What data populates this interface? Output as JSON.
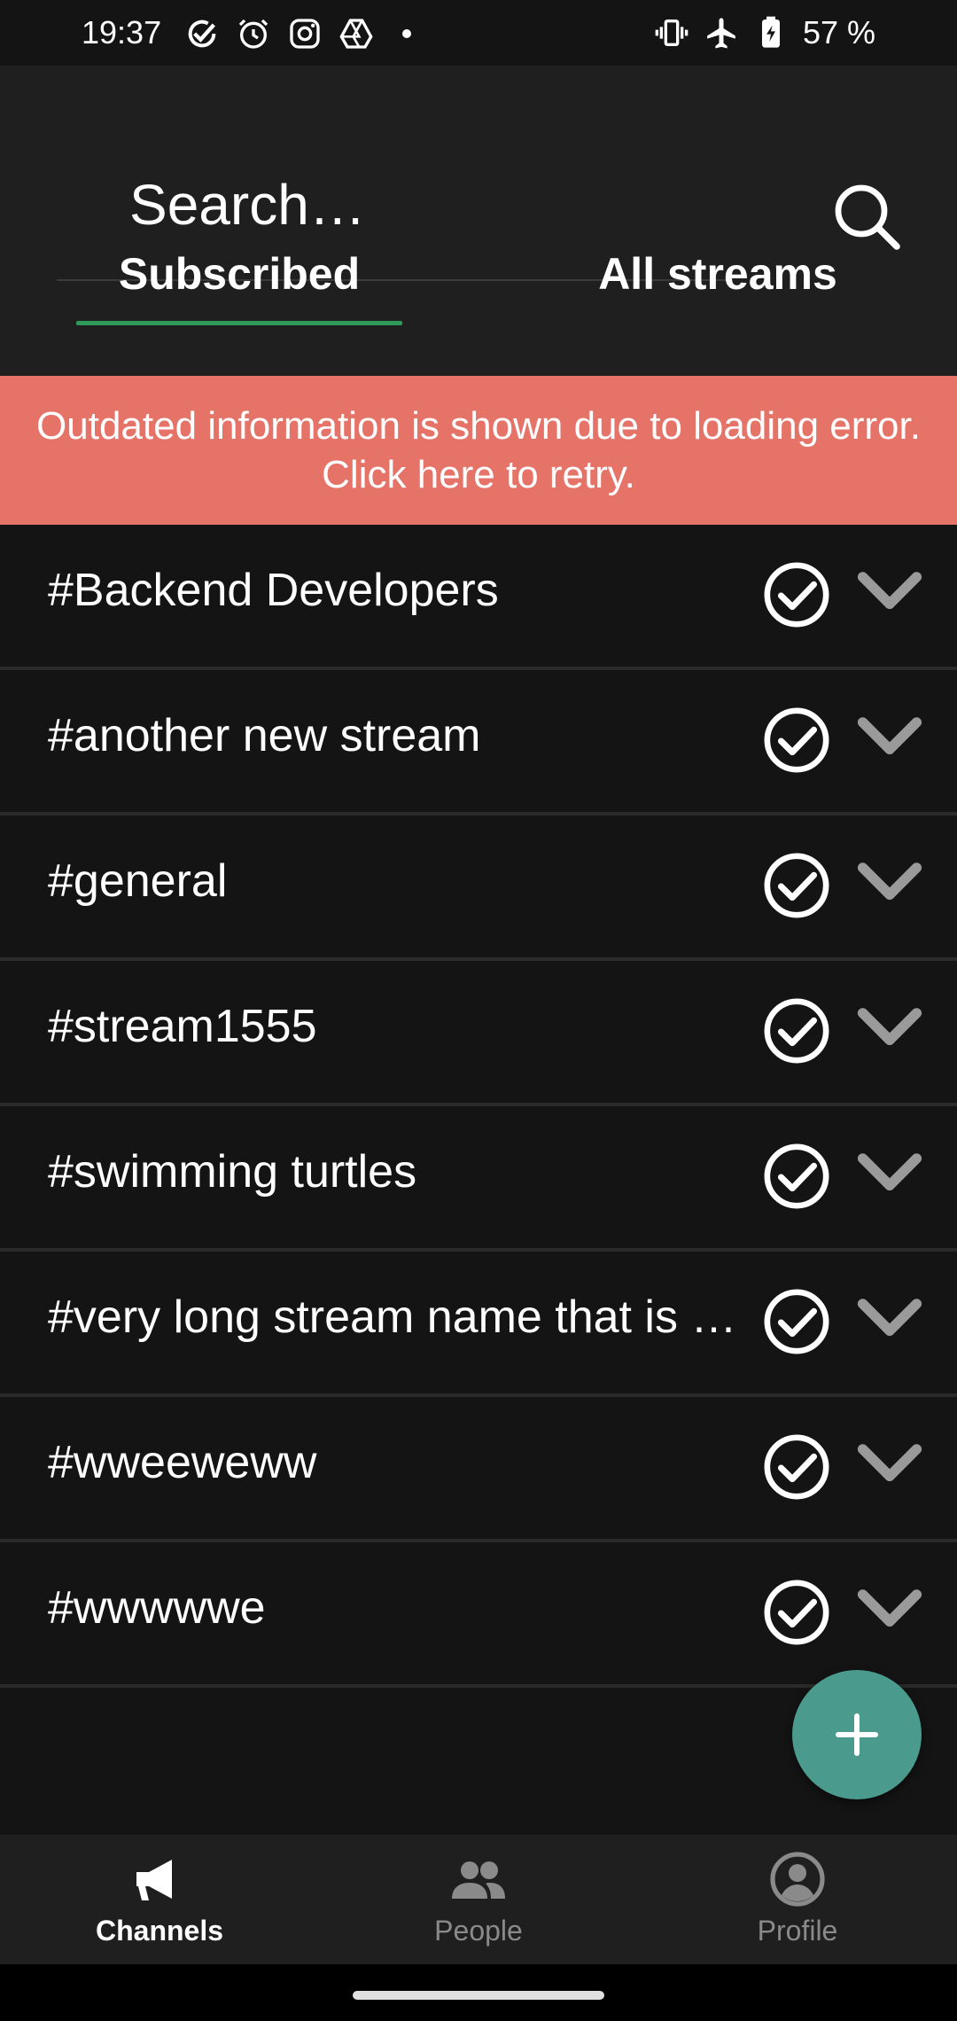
{
  "status_bar": {
    "time": "19:37",
    "battery": "57 %",
    "left_icons": [
      "check-circle-icon",
      "alarm-icon",
      "instagram-icon",
      "drive-icon",
      "dot-icon"
    ],
    "right_icons": [
      "vibrate-icon",
      "airplane-icon",
      "battery-charging-icon"
    ]
  },
  "search": {
    "placeholder": "Search…"
  },
  "tabs": [
    {
      "label": "Subscribed",
      "active": true
    },
    {
      "label": "All streams",
      "active": false
    }
  ],
  "error_banner": {
    "text": "Outdated information is shown due to loading error. Click here to retry."
  },
  "streams": [
    {
      "name": "#Backend Developers",
      "subscribed": true
    },
    {
      "name": "#another new stream",
      "subscribed": true
    },
    {
      "name": "#general",
      "subscribed": true
    },
    {
      "name": "#stream1555",
      "subscribed": true
    },
    {
      "name": "#swimming turtles",
      "subscribed": true
    },
    {
      "name": "#very long stream name that is t…",
      "subscribed": true
    },
    {
      "name": "#wweeweww",
      "subscribed": true
    },
    {
      "name": "#wwwwwe",
      "subscribed": true
    }
  ],
  "fab": {
    "icon": "plus-icon"
  },
  "bottom_nav": [
    {
      "label": "Channels",
      "icon": "megaphone-icon",
      "active": true
    },
    {
      "label": "People",
      "icon": "people-icon",
      "active": false
    },
    {
      "label": "Profile",
      "icon": "profile-icon",
      "active": false
    }
  ],
  "colors": {
    "background": "#141414",
    "header": "#1f1f1f",
    "error_banner": "#e57368",
    "tab_indicator": "#2e9a5a",
    "fab": "#4a9b8e"
  }
}
